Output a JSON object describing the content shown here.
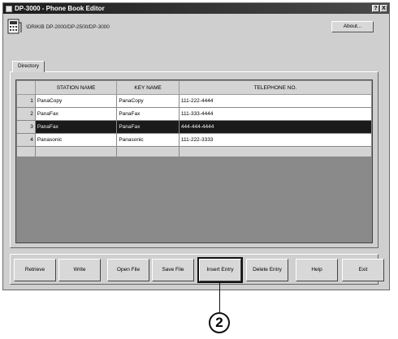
{
  "window": {
    "title": "DP-3000 - Phone Book Editor"
  },
  "titlebar_buttons": [
    "?",
    "X"
  ],
  "path": "\\DRIKIB DP-2000/DP-2500/DP-3000",
  "about_label": "About...",
  "tab_label": "Directory",
  "table": {
    "columns": [
      "",
      "STATION NAME",
      "KEY NAME",
      "TELEPHONE NO."
    ],
    "rows": [
      {
        "num": "1",
        "station": "PanaCopy",
        "key": "PanaCopy",
        "tel": "111-222-4444"
      },
      {
        "num": "2",
        "station": "PanaFax",
        "key": "PanaFax",
        "tel": "111-333-4444"
      },
      {
        "num": "3",
        "station": "PanaFax",
        "key": "PanaFax",
        "tel": "444-444-4444"
      },
      {
        "num": "4",
        "station": "Panasonic",
        "key": "Panasonic",
        "tel": "111-222-3333"
      }
    ],
    "selected_row": 3
  },
  "buttons": {
    "retrieve": "Retrieve",
    "write": "Write",
    "open_file": "Open File",
    "save_file": "Save File",
    "insert_entry": "Insert Entry",
    "delete_entry": "Delete Entry",
    "help": "Help",
    "exit": "Exit"
  },
  "callout_number": "2"
}
